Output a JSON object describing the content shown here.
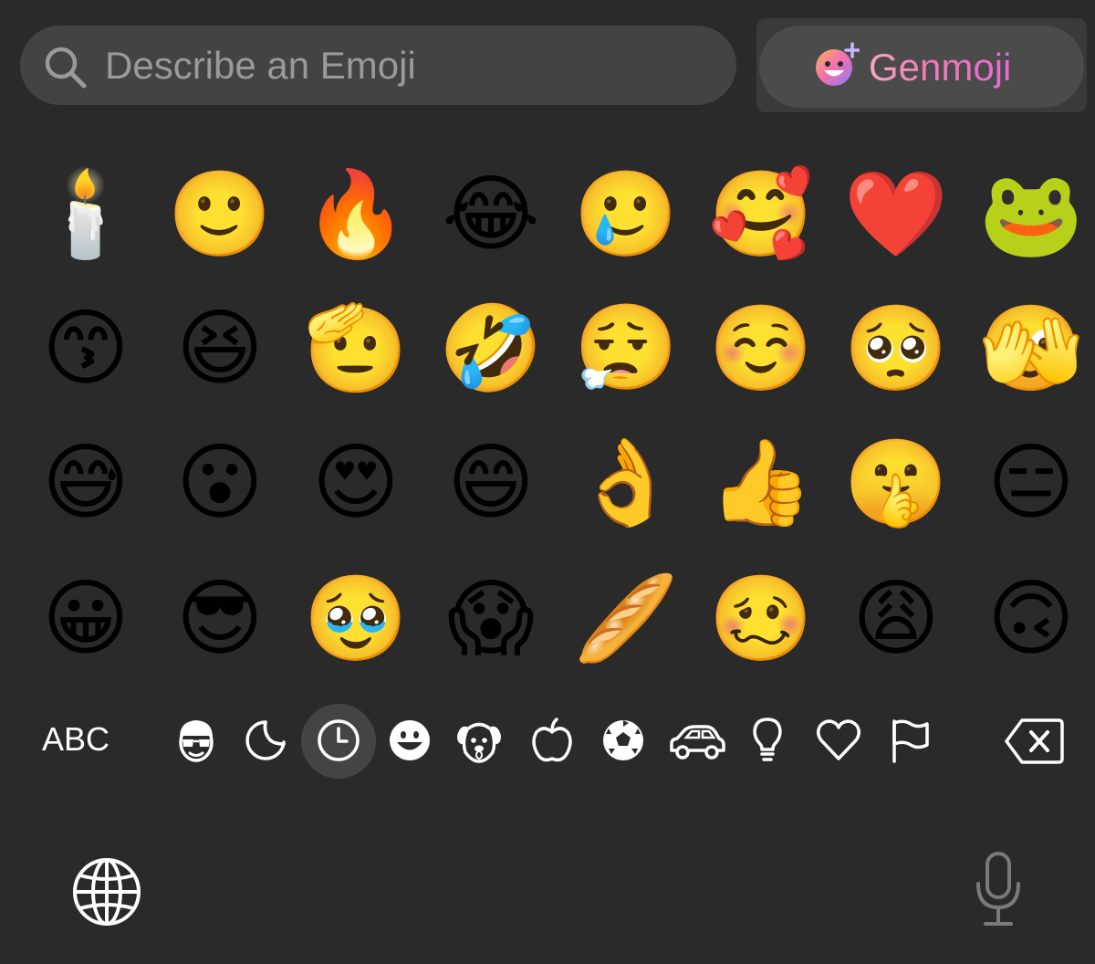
{
  "search": {
    "placeholder": "Describe an Emoji",
    "icon": "search-icon"
  },
  "genmoji": {
    "label": "Genmoji",
    "icon": "genmoji-face-plus-icon",
    "label_gradient": [
      "#f6a6c6",
      "#e36bd6"
    ]
  },
  "emoji_rows": [
    [
      "🕯️",
      "🙂",
      "🔥",
      "😂",
      "🥲",
      "🥰",
      "❤️",
      "🐸"
    ],
    [
      "😙",
      "😆",
      "🫡",
      "🤣",
      "😮‍💨",
      "☺️",
      "🥺",
      "🫣"
    ],
    [
      "😅",
      "😮",
      "😍",
      "😄",
      "👌",
      "👍",
      "🤫",
      "😑"
    ],
    [
      "😀",
      "😎",
      "🥹",
      "😱",
      "🥖",
      "🥴",
      "😩",
      "🙃"
    ]
  ],
  "category_bar": {
    "abc_label": "ABC",
    "categories": [
      {
        "name": "memoji",
        "icon": "memoji-face-icon",
        "active": false
      },
      {
        "name": "stickers",
        "icon": "sticker-icon",
        "active": false
      },
      {
        "name": "frequently-used",
        "icon": "clock-icon",
        "active": true
      },
      {
        "name": "smileys-people",
        "icon": "smiley-icon",
        "active": false
      },
      {
        "name": "animals-nature",
        "icon": "dog-icon",
        "active": false
      },
      {
        "name": "food-drink",
        "icon": "apple-icon",
        "active": false
      },
      {
        "name": "activity",
        "icon": "soccer-ball-icon",
        "active": false
      },
      {
        "name": "travel-places",
        "icon": "car-icon",
        "active": false
      },
      {
        "name": "objects",
        "icon": "lightbulb-icon",
        "active": false
      },
      {
        "name": "symbols",
        "icon": "heart-icon",
        "active": false
      },
      {
        "name": "flags",
        "icon": "flag-icon",
        "active": false
      }
    ],
    "delete_icon": "delete-backspace-icon"
  },
  "bottom": {
    "globe_icon": "globe-icon",
    "mic_icon": "microphone-icon"
  },
  "colors": {
    "background": "#2a2a2a",
    "search_bg": "#434343",
    "active_category_bg": "#444444"
  }
}
